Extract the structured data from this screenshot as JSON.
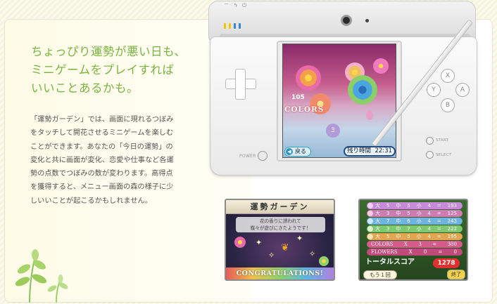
{
  "headline": [
    "ちょっぴり運勢が悪い日も、",
    "ミニゲームをプレイすれば",
    "いいことあるかも。"
  ],
  "body": [
    "「運勢ガーデン」では、画面に現れるつぼみ",
    "をタッチして開花させるミニゲームを楽しむ",
    "ことができます。あなたの「今日の運勢」の",
    "変化と共に画面が変化、恋愛や仕事など各運",
    "勢の点数でつぼみの数が変わります。高得点",
    "を獲得すると、メニュー画面の森の様子に少",
    "しいいことが起こるかもしれません。"
  ],
  "ds": {
    "power_label": "POWER",
    "start_label": "START",
    "select_label": "SELECT",
    "buttons": {
      "x": "X",
      "y": "Y",
      "a": "A",
      "b": "B"
    },
    "status_icons": "⌔ ϟ ⏻"
  },
  "screen": {
    "score": "105",
    "colors_label": "COLORS",
    "bubble": "3",
    "back_label": "戻る",
    "timer_label": "残り時間",
    "timer_value": "22:31"
  },
  "shot1": {
    "title": "運勢ガーデン",
    "message": [
      "花の香りに誘われて",
      "蝶々が遊びにきたようです！"
    ],
    "congrats": "CONGRATULATIONS!"
  },
  "shot2": {
    "rows": [
      {
        "size": "大",
        "a": "5",
        "mid": "中",
        "b": "5",
        "small": "小",
        "c": "4",
        "eq": "=",
        "total": "193"
      },
      {
        "size": "大",
        "a": "3",
        "mid": "中",
        "b": "5",
        "small": "小",
        "c": "4",
        "eq": "=",
        "total": "125"
      },
      {
        "size": "大",
        "a": "7",
        "mid": "中",
        "b": "6",
        "small": "小",
        "c": "4",
        "eq": "=",
        "total": "243"
      },
      {
        "size": "大",
        "a": "3",
        "mid": "中",
        "b": "7",
        "small": "小",
        "c": "4",
        "eq": "=",
        "total": "222"
      },
      {
        "size": "大",
        "a": "5",
        "mid": "中",
        "b": "5",
        "small": "小",
        "c": "4",
        "eq": "=",
        "total": "195"
      }
    ],
    "colors_row": {
      "label": "COLORS",
      "x": "X",
      "n": "3",
      "eq": "=",
      "total": "300"
    },
    "flowers_row": {
      "label": "FLOWERS",
      "x": "X",
      "n": "0",
      "eq": "=",
      "total": "0"
    },
    "total_label": "トータルスコア",
    "total_value": "1278",
    "retry_label": "もう１回",
    "end_label": "終了"
  },
  "colors": {
    "headline": "#7ab440",
    "row_colors": [
      "#c78ad9",
      "#d07ab5",
      "#6fb4de",
      "#7ec86e",
      "#e2a651"
    ]
  }
}
